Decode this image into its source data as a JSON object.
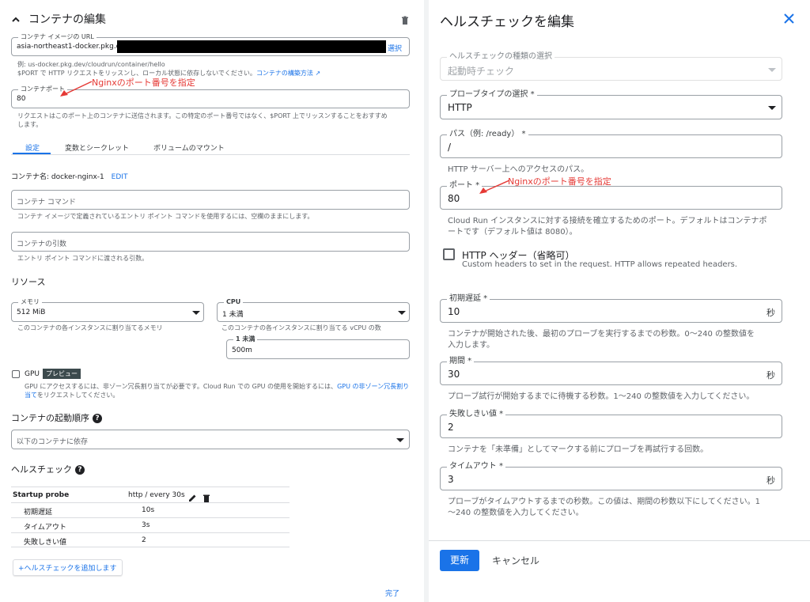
{
  "left": {
    "title": "コンテナの編集",
    "image_url": {
      "label": "コンテナ イメージの URL",
      "value": "asia-northeast1-docker.pkg.dev/",
      "select": "選択",
      "help_line1": "例: us-docker.pkg.dev/cloudrun/container/hello",
      "help_line2": "$PORT で HTTP リクエストをリッスンし、ローカル状態に依存しないでください。",
      "help_link": "コンテナの構築方法"
    },
    "port": {
      "label": "コンテナポート",
      "value": "80",
      "annotation": "Nginxのポート番号を指定",
      "help_line1": "リクエストはこのポート上のコンテナに送信されます。この特定のポート番号ではなく、$PORT 上でリッスンすることをおすすめ",
      "help_line2": "します。"
    },
    "tabs": [
      "設定",
      "変数とシークレット",
      "ボリュームのマウント"
    ],
    "container_name_label": "コンテナ名: docker-nginx-1",
    "edit": "EDIT",
    "command": {
      "placeholder": "コンテナ コマンド",
      "help": "コンテナ イメージで定義されているエントリ ポイント コマンドを使用するには、空欄のままにします。"
    },
    "args": {
      "placeholder": "コンテナの引数",
      "help": "エントリ ポイント コマンドに渡される引数。"
    },
    "resources_heading": "リソース",
    "memory": {
      "label": "メモリ",
      "value": "512 MiB",
      "help": "このコンテナの各インスタンスに割り当てるメモリ"
    },
    "cpu": {
      "label": "CPU",
      "value": "1 未満",
      "help": "このコンテナの各インスタンスに割り当てる vCPU の数"
    },
    "cpu_sub": {
      "label": "1 未満",
      "value": "500m"
    },
    "gpu": {
      "label": "GPU",
      "badge": "プレビュー",
      "help_line1_a": "GPU にアクセスするには、非ゾーン冗長割り当てが必要です。Cloud Run での GPU の使用を開始するには、",
      "help_link_a": "GPU の非ゾーン冗長割り",
      "help_link_b": "当て",
      "help_line2_b": "をリクエストしてください。"
    },
    "startup_order": {
      "heading": "コンテナの起動順序",
      "value": "以下のコンテナに依存"
    },
    "healthcheck": {
      "heading": "ヘルスチェック",
      "probe_name": "Startup probe",
      "probe_summary": "http / every 30s",
      "rows": [
        {
          "label": "初期遅延",
          "value": "10s"
        },
        {
          "label": "タイムアウト",
          "value": "3s"
        },
        {
          "label": "失敗しきい値",
          "value": "2"
        }
      ],
      "add_button": "+ヘルスチェックを追加します"
    },
    "done": "完了"
  },
  "right": {
    "title": "ヘルスチェックを編集",
    "type": {
      "label": "ヘルスチェックの種類の選択",
      "value": "起動時チェック"
    },
    "probe_type": {
      "label": "プローブタイプの選択 *",
      "value": "HTTP"
    },
    "path": {
      "label": "パス（例: /ready） *",
      "value": "/",
      "help": "HTTP サーバー上へのアクセスのパス。"
    },
    "port": {
      "label": "ポート *",
      "value": "80",
      "annotation": "Nginxのポート番号を指定",
      "help_line1": "Cloud Run インスタンスに対する接続を確立するためのポート。デフォルトはコンテナポ",
      "help_line2": "ートです（デフォルト値は 8080）。"
    },
    "headers": {
      "label": "HTTP ヘッダー（省略可）",
      "help": "Custom headers to set in the request. HTTP allows repeated headers."
    },
    "initial_delay": {
      "label": "初期遅延 *",
      "value": "10",
      "unit": "秒",
      "help_line1": "コンテナが開始された後、最初のプローブを実行するまでの秒数。0〜240 の整数値を",
      "help_line2": "入力します。"
    },
    "period": {
      "label": "期間 *",
      "value": "30",
      "unit": "秒",
      "help": "プローブ試行が開始するまでに待機する秒数。1〜240 の整数値を入力してください。"
    },
    "failure_threshold": {
      "label": "失敗しきい値 *",
      "value": "2",
      "help": "コンテナを「未準備」としてマークする前にプローブを再試行する回数。"
    },
    "timeout": {
      "label": "タイムアウト *",
      "value": "3",
      "unit": "秒",
      "help_line1": "プローブがタイムアウトするまでの秒数。この値は、期間の秒数以下にしてください。1",
      "help_line2": "〜240 の整数値を入力してください。"
    },
    "update_button": "更新",
    "cancel_button": "キャンセル"
  }
}
